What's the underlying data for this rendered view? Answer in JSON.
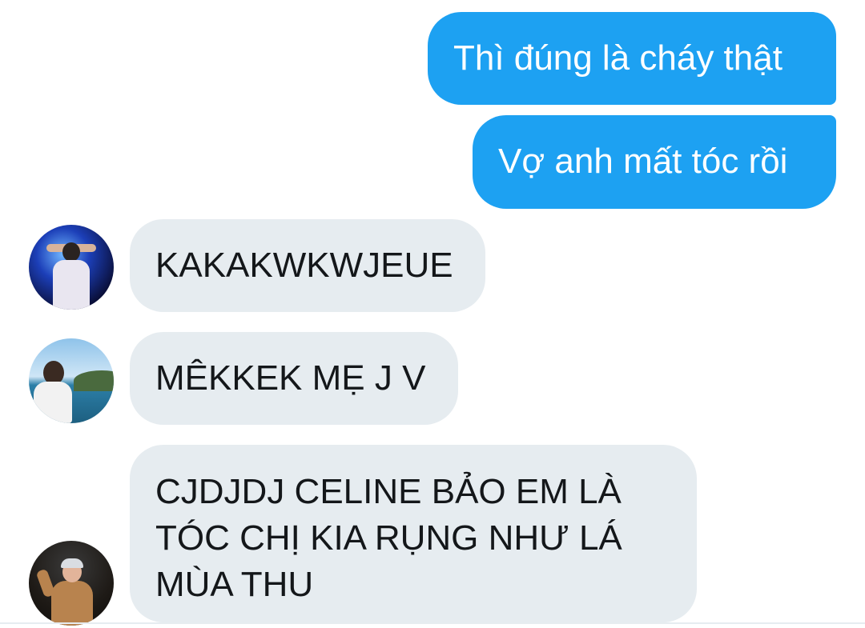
{
  "conversation": {
    "messages": [
      {
        "direction": "sent",
        "text": "Thì đúng là cháy thật"
      },
      {
        "direction": "sent",
        "text": "Vợ anh mất tóc rồi"
      },
      {
        "direction": "received",
        "avatar": "user-avatar-1",
        "text": "KAKAKWKWJEUE"
      },
      {
        "direction": "received",
        "avatar": "user-avatar-2",
        "text": "MÊKKEK MẸ J V"
      },
      {
        "direction": "received",
        "avatar": "user-avatar-3",
        "lines": [
          "CJDJDJ CELINE BẢO EM LÀ",
          "TÓC CHỊ KIA RỤNG NHƯ LÁ",
          "MÙA THU"
        ]
      }
    ]
  },
  "colors": {
    "sent_bubble": "#1da1f2",
    "received_bubble": "#e6ecf0",
    "sent_text": "#ffffff",
    "received_text": "#14171a"
  }
}
